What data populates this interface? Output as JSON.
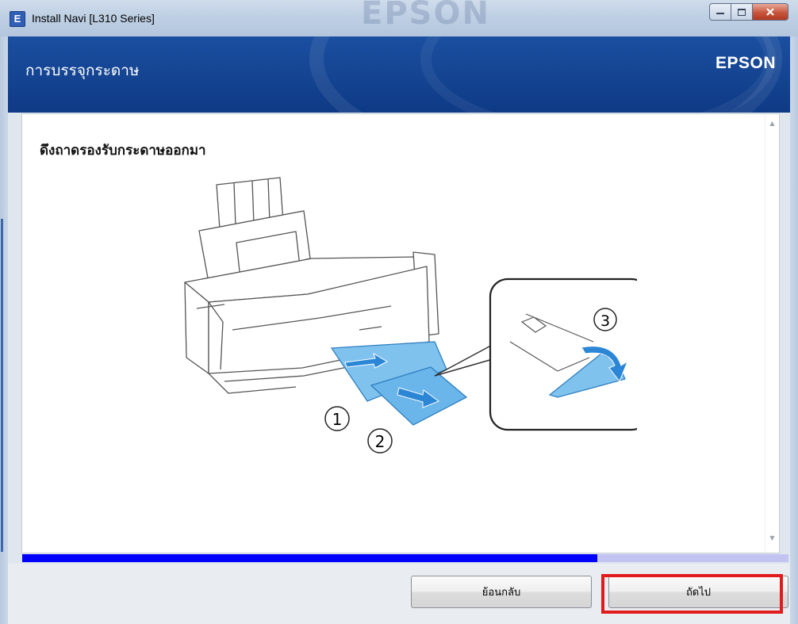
{
  "window": {
    "icon_letter": "E",
    "title": "Install Navi [L310 Series]",
    "controls": {
      "minimize_icon": "minimize-icon",
      "maximize_icon": "maximize-icon",
      "close_icon": "close-icon"
    }
  },
  "header": {
    "heading": "การบรรจุกระดาษ",
    "brand": "EPSON",
    "background_color": "#0e3a85"
  },
  "content": {
    "step_title": "ดึงถาดรองรับกระดาษออกมา",
    "illustration": {
      "callouts": [
        "1",
        "2",
        "3"
      ],
      "accent_color": "#3a98e0"
    }
  },
  "progress": {
    "fraction": 0.75,
    "fill_color": "#0000ff",
    "track_color": "#c3c3f2"
  },
  "buttons": {
    "back_label": "ย้อนกลับ",
    "next_label": "ถัดไป",
    "highlight_color": "#e11b1b"
  }
}
